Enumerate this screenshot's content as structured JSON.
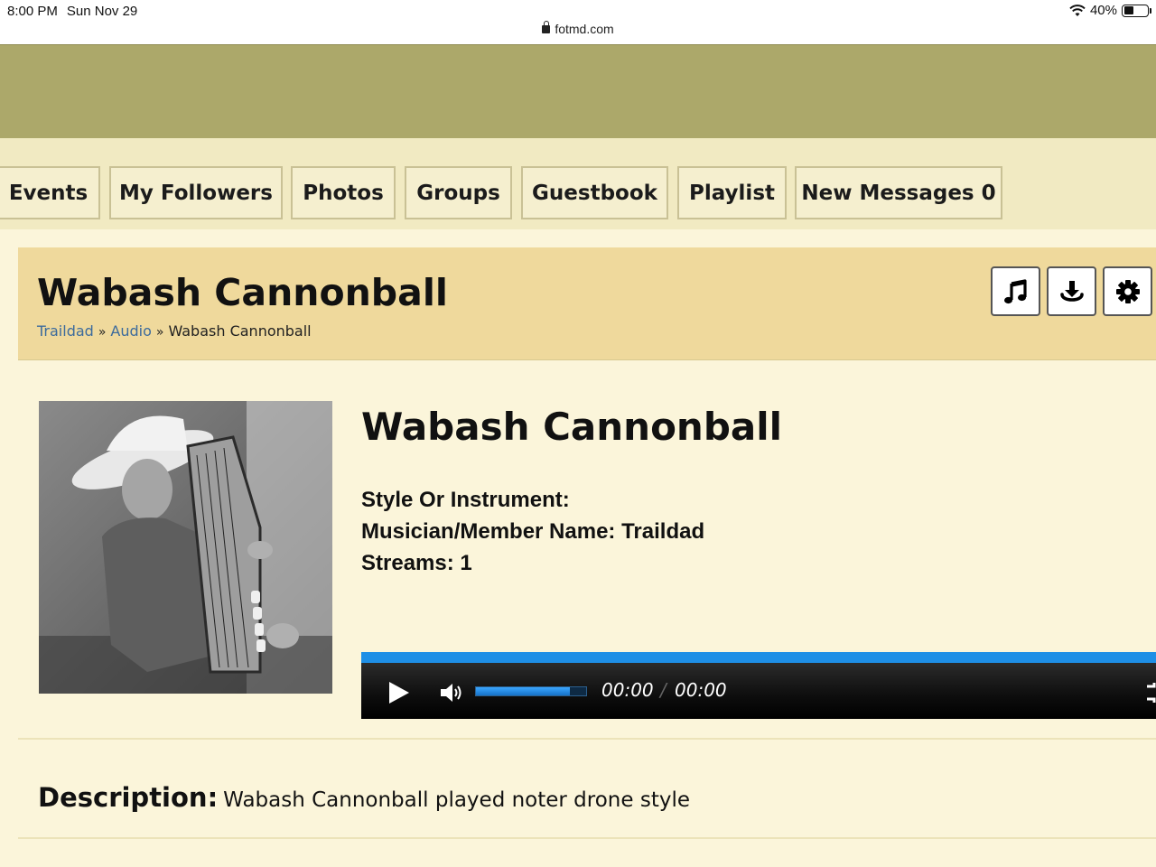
{
  "status_bar": {
    "time": "8:00 PM",
    "date": "Sun Nov 29",
    "battery": "40%",
    "battery_level": 0.4,
    "url": "fotmd.com"
  },
  "nav": {
    "items": [
      {
        "label": "Events"
      },
      {
        "label": "My Followers"
      },
      {
        "label": "Photos"
      },
      {
        "label": "Groups"
      },
      {
        "label": "Guestbook"
      },
      {
        "label": "Playlist"
      },
      {
        "label": "New Messages 0"
      }
    ]
  },
  "header": {
    "title": "Wabash Cannonball",
    "breadcrumb": {
      "user": "Traildad",
      "section": "Audio",
      "current": "Wabash Cannonball",
      "separator": "»"
    },
    "tools": [
      "music-note-icon",
      "download-icon",
      "gear-icon"
    ]
  },
  "detail": {
    "title": "Wabash Cannonball",
    "style_label": "Style Or Instrument:",
    "style_value": "",
    "musician_label": "Musician/Member Name:",
    "musician_value": "Traildad",
    "streams_label": "Streams:",
    "streams_value": "1"
  },
  "player": {
    "current_time": "00:00",
    "separator": "/",
    "duration": "00:00",
    "volume_level": 0.85,
    "accent": "#1e8fe6"
  },
  "description": {
    "label": "Description:",
    "text": "Wabash Cannonball played noter drone style"
  },
  "colors": {
    "banner": "#aca86a",
    "nav_bg": "#f1eac2",
    "header_bg": "#efd99c",
    "page_bg": "#fbf5da",
    "link": "#3c6b9c"
  }
}
